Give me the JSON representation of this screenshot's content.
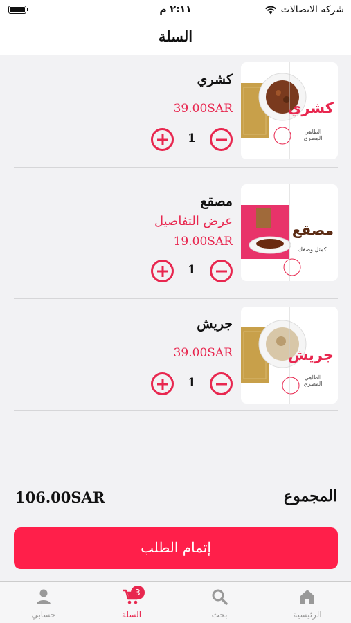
{
  "status_bar": {
    "carrier": "شركة الاتصالات",
    "time": "٢:١١ م"
  },
  "header": {
    "title": "السلة"
  },
  "cart": {
    "items": [
      {
        "name": "كشري",
        "price": "39.00SAR",
        "quantity": "1",
        "image_text": "كشري",
        "image_sub": "الطاهي المصري"
      },
      {
        "name": "مصقع",
        "detail_link": "عرض التفاصيل",
        "price": "19.00SAR",
        "quantity": "1",
        "image_text": "مصقع",
        "image_sub": "كمثل وصفك"
      },
      {
        "name": "جريش",
        "price": "39.00SAR",
        "quantity": "1",
        "image_text": "جريش",
        "image_sub": "الطاهي المصري"
      }
    ]
  },
  "summary": {
    "total_label": "المجموع",
    "total_value": "106.00SAR"
  },
  "checkout_button": {
    "label": "إتمام الطلب"
  },
  "tab_bar": {
    "tabs": [
      {
        "label": "الرئيسية",
        "icon": "home-icon"
      },
      {
        "label": "بحث",
        "icon": "search-icon"
      },
      {
        "label": "السلة",
        "icon": "cart-icon",
        "badge": "3",
        "active": true
      },
      {
        "label": "حسابي",
        "icon": "person-icon"
      }
    ]
  },
  "colors": {
    "accent": "#e8274f",
    "checkout": "#ff1f4a",
    "background": "#f2f2f4"
  }
}
